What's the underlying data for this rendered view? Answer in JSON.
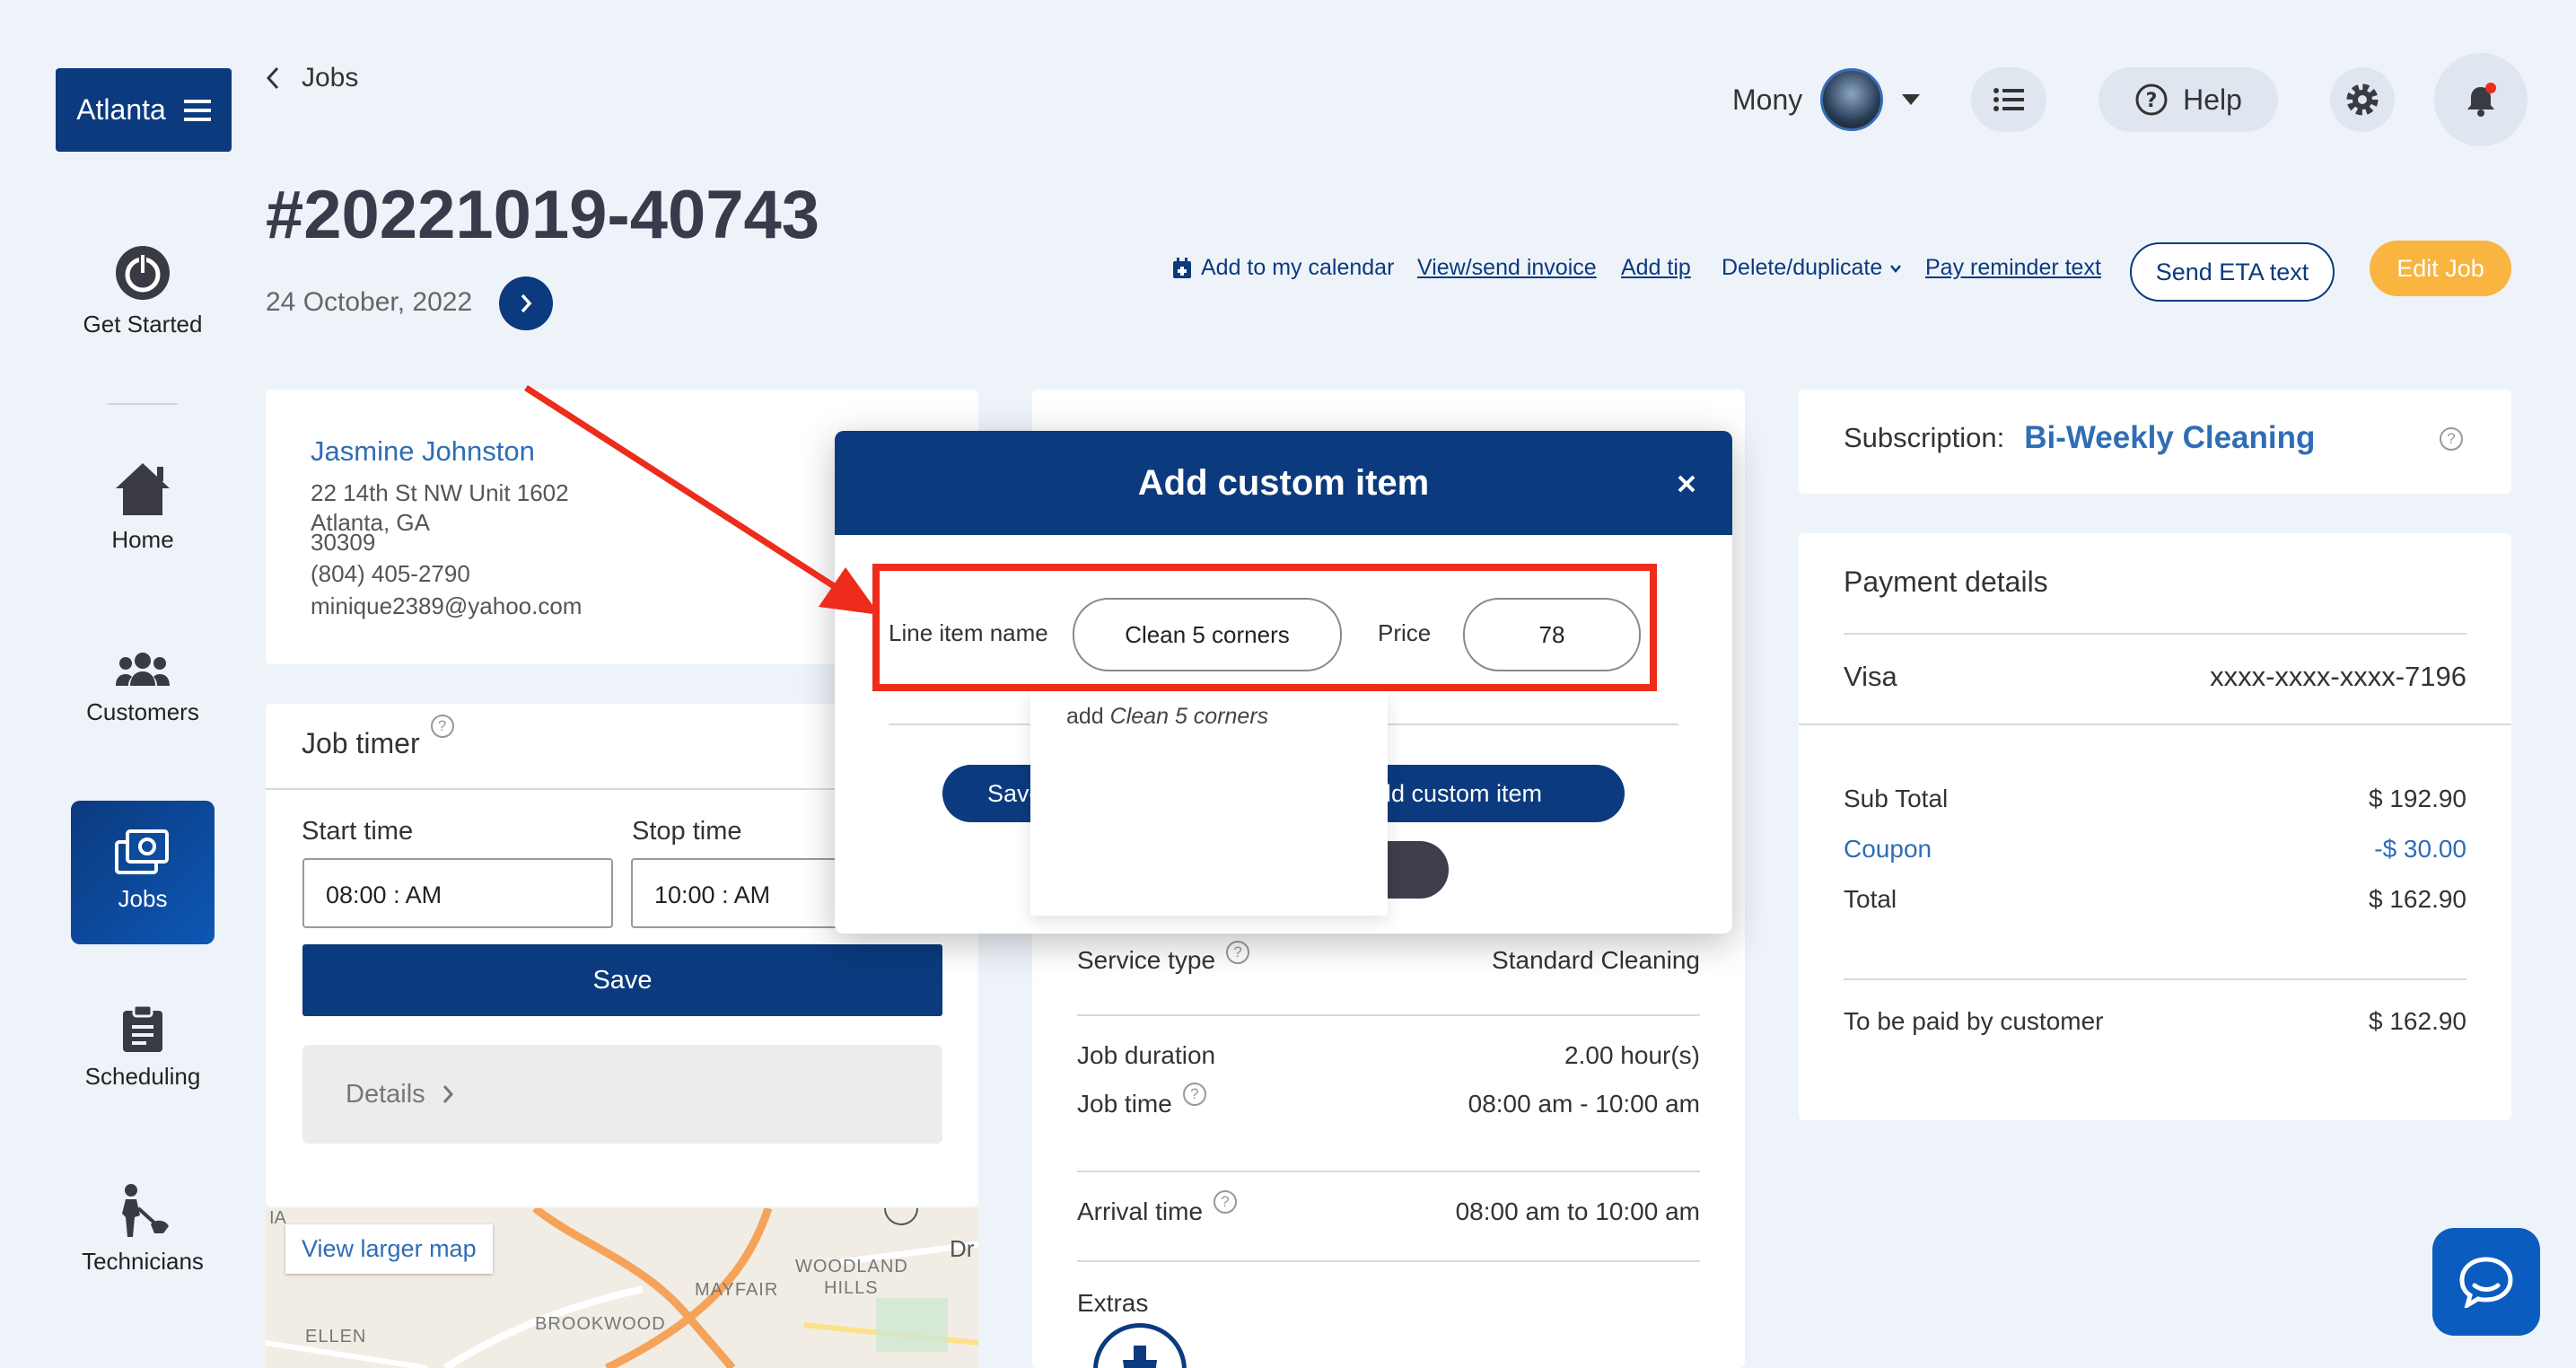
{
  "location": "Atlanta",
  "back_label": "Jobs",
  "job_number": "#20221019-40743",
  "job_date": "24 October, 2022",
  "user": {
    "name": "Mony"
  },
  "help_label": "Help",
  "nav": {
    "get_started": "Get Started",
    "home": "Home",
    "customers": "Customers",
    "jobs": "Jobs",
    "scheduling": "Scheduling",
    "technicians": "Technicians"
  },
  "actions": {
    "calendar": "Add to my calendar",
    "invoice": "View/send invoice",
    "tip": "Add tip",
    "delete": "Delete/duplicate",
    "reminder": "Pay reminder text",
    "eta": "Send ETA text",
    "edit": "Edit Job"
  },
  "customer": {
    "name": "Jasmine Johnston",
    "address1": "22 14th St NW Unit 1602",
    "address2": "Atlanta, GA",
    "zip": "30309",
    "phone": "(804) 405-2790",
    "email": "minique2389@yahoo.com"
  },
  "timer": {
    "title": "Job timer",
    "start_label": "Start time",
    "stop_label": "Stop time",
    "start_value": "08:00 : AM",
    "stop_value": "10:00 : AM",
    "save": "Save",
    "details": "Details"
  },
  "map": {
    "view_larger": "View larger map",
    "labels": [
      "WOODLAND",
      "HILLS",
      "MAYFAIR",
      "BROOKWOOD",
      "ELLEN",
      "IA",
      "Dr"
    ]
  },
  "modal": {
    "title": "Add custom item",
    "line_item_label": "Line item name",
    "line_item_value": "Clean 5 corners",
    "price_label": "Price",
    "price_value": "78",
    "suggestion_prefix": "add",
    "suggestion_item": "Clean 5 corners",
    "save_partial": "Save",
    "add_partial": "dd custom item"
  },
  "service": {
    "service_type_label": "Service type",
    "service_type_value": "Standard Cleaning",
    "duration_label": "Job duration",
    "duration_value": "2.00 hour(s)",
    "job_time_label": "Job time",
    "job_time_value": "08:00 am - 10:00 am",
    "arrival_label": "Arrival time",
    "arrival_value": "08:00 am to 10:00 am",
    "extras_label": "Extras"
  },
  "subscription": {
    "label": "Subscription:",
    "value": "Bi-Weekly Cleaning"
  },
  "payment": {
    "title": "Payment details",
    "card_type": "Visa",
    "card_number": "xxxx-xxxx-xxxx-7196",
    "subtotal_label": "Sub Total",
    "subtotal_value": "$ 192.90",
    "coupon_label": "Coupon",
    "coupon_value": "-$ 30.00",
    "total_label": "Total",
    "total_value": "$ 162.90",
    "paid_label": "To be paid by customer",
    "paid_value": "$ 162.90"
  },
  "colors": {
    "navy": "#0b3a7e",
    "accent": "#f9b540",
    "link": "#2f6db5",
    "annotation": "#ee2c1b"
  }
}
